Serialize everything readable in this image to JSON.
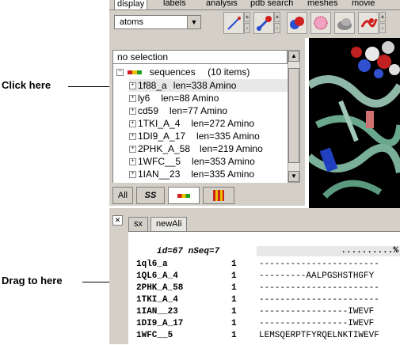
{
  "annotations": {
    "click_here": "Click here",
    "drag_to_here": "Drag to here"
  },
  "tabs": [
    "display",
    "labels",
    "analysis",
    "pdb search",
    "meshes",
    "movie"
  ],
  "active_tab": "display",
  "toolbar": {
    "select_value": "atoms",
    "icons": [
      "line-draw-icon",
      "ball-stick-icon",
      "spacefill-icon",
      "mesh-icon",
      "cloud-icon",
      "ribbon-icon"
    ]
  },
  "tree": {
    "header": "no selection",
    "root": {
      "label": "sequences",
      "count": "(10 items)"
    },
    "items": [
      {
        "name": "1f88_a",
        "len": "len=338 Amino"
      },
      {
        "name": "ly6",
        "len": "len=88 Amino"
      },
      {
        "name": "cd59",
        "len": "len=77 Amino"
      },
      {
        "name": "1TKI_A_4",
        "len": "len=272 Amino"
      },
      {
        "name": "1DI9_A_17",
        "len": "len=335 Amino"
      },
      {
        "name": "2PHK_A_58",
        "len": "len=219 Amino"
      },
      {
        "name": "1WFC__5",
        "len": "len=353 Amino"
      },
      {
        "name": "1IAN__23",
        "len": "len=335 Amino"
      }
    ],
    "bottom_tabs": [
      "All",
      "SS"
    ]
  },
  "alignment": {
    "tabs": [
      "sx",
      "newAli"
    ],
    "info": "id=67 nSeq=7",
    "ruler": "..........%",
    "rows": [
      {
        "name": "1ql6_a",
        "num": "1",
        "seq": "-----------------------"
      },
      {
        "name": "1QL6_A_4",
        "num": "1",
        "seq": "---------AALPGSHSTHGFY"
      },
      {
        "name": "2PHK_A_58",
        "num": "1",
        "seq": "-----------------------"
      },
      {
        "name": "1TKI_A_4",
        "num": "1",
        "seq": "-----------------------"
      },
      {
        "name": "1IAN__23",
        "num": "1",
        "seq": "-----------------IWEVF"
      },
      {
        "name": "1DI9_A_17",
        "num": "1",
        "seq": "-----------------IWEVF"
      },
      {
        "name": "1WFC__5",
        "num": "1",
        "seq": "LEMSQERPTFYRQELNKTIWEVF"
      }
    ]
  }
}
